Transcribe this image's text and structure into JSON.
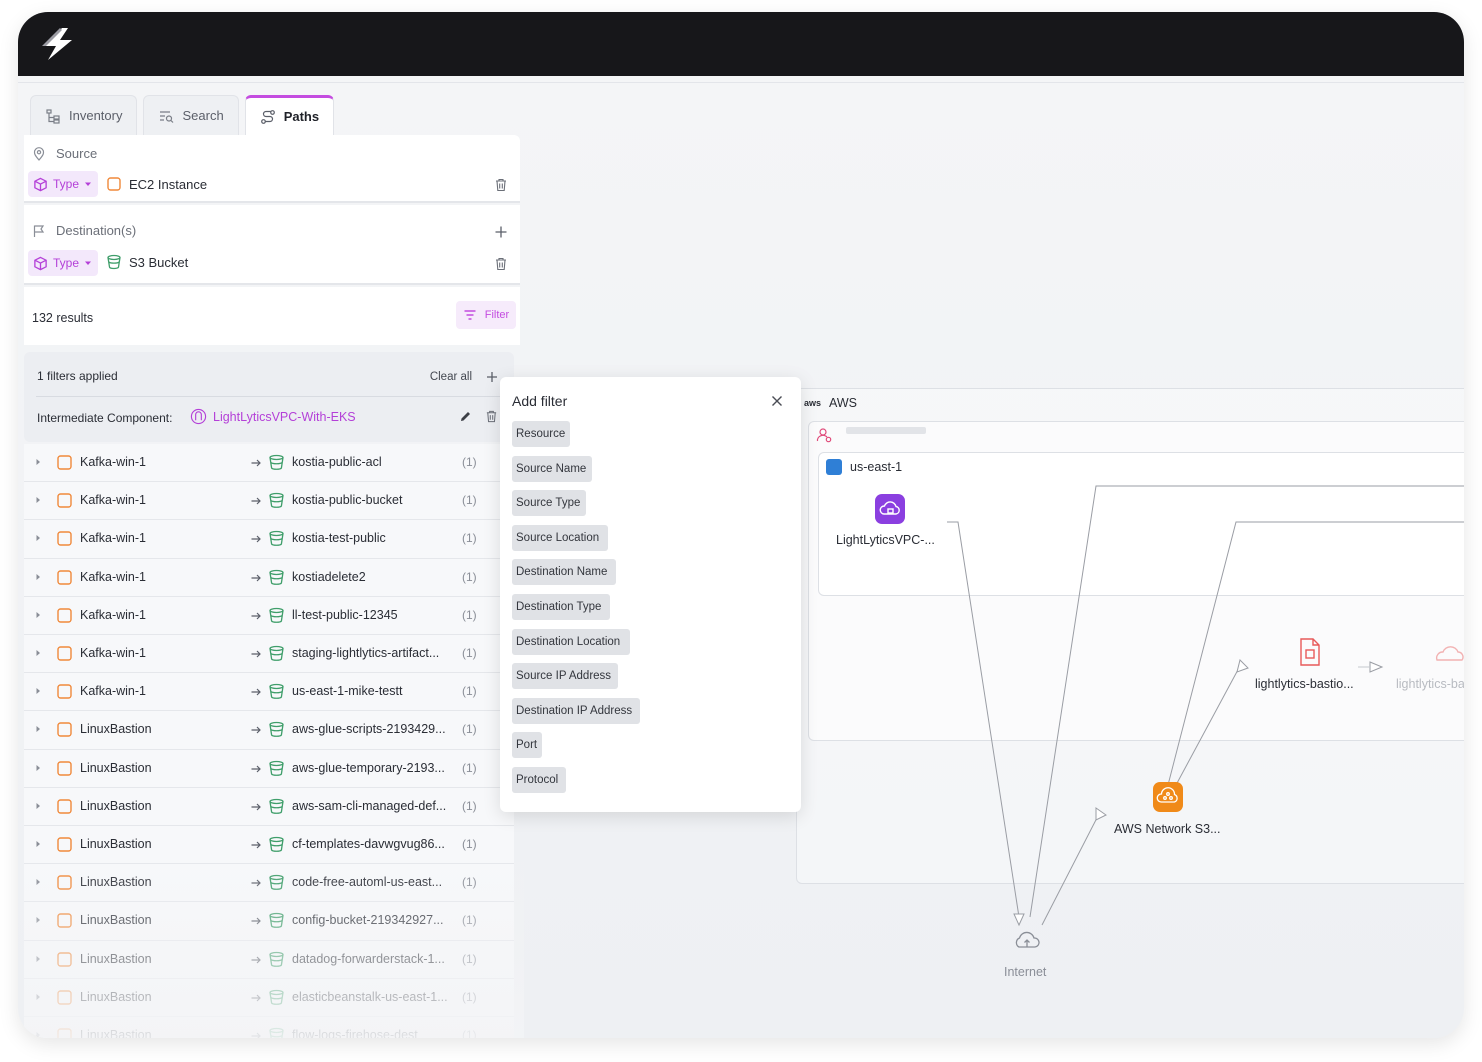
{
  "tabs": [
    {
      "label": "Inventory",
      "icon": "tree-icon"
    },
    {
      "label": "Search",
      "icon": "list-search-icon"
    },
    {
      "label": "Paths",
      "icon": "route-icon"
    }
  ],
  "source": {
    "label": "Source",
    "type_label": "Type",
    "entity": "EC2 Instance"
  },
  "destination": {
    "label": "Destination(s)",
    "type_label": "Type",
    "entity": "S3 Bucket"
  },
  "results": {
    "count_text": "132 results",
    "filter_label": "Filter"
  },
  "applied_filters": {
    "header": "1 filters applied",
    "clear_all": "Clear all",
    "component_label": "Intermediate Component:",
    "component_value": "LightLyticsVPC-With-EKS"
  },
  "paths": [
    {
      "source": "Kafka-win-1",
      "destination": "kostia-public-acl",
      "count": "(1)"
    },
    {
      "source": "Kafka-win-1",
      "destination": "kostia-public-bucket",
      "count": "(1)"
    },
    {
      "source": "Kafka-win-1",
      "destination": "kostia-test-public",
      "count": "(1)"
    },
    {
      "source": "Kafka-win-1",
      "destination": "kostiadelete2",
      "count": "(1)"
    },
    {
      "source": "Kafka-win-1",
      "destination": "ll-test-public-12345",
      "count": "(1)"
    },
    {
      "source": "Kafka-win-1",
      "destination": "staging-lightlytics-artifact...",
      "count": "(1)"
    },
    {
      "source": "Kafka-win-1",
      "destination": "us-east-1-mike-testt",
      "count": "(1)"
    },
    {
      "source": "LinuxBastion",
      "destination": "aws-glue-scripts-2193429...",
      "count": "(1)"
    },
    {
      "source": "LinuxBastion",
      "destination": "aws-glue-temporary-2193...",
      "count": "(1)"
    },
    {
      "source": "LinuxBastion",
      "destination": "aws-sam-cli-managed-def...",
      "count": "(1)"
    },
    {
      "source": "LinuxBastion",
      "destination": "cf-templates-davwgvug86...",
      "count": "(1)"
    },
    {
      "source": "LinuxBastion",
      "destination": "code-free-automl-us-east...",
      "count": "(1)"
    },
    {
      "source": "LinuxBastion",
      "destination": "config-bucket-219342927...",
      "count": "(1)"
    },
    {
      "source": "LinuxBastion",
      "destination": "datadog-forwarderstack-1...",
      "count": "(1)"
    },
    {
      "source": "LinuxBastion",
      "destination": "elasticbeanstalk-us-east-1...",
      "count": "(1)"
    },
    {
      "source": "LinuxBastion",
      "destination": "flow-logs-firehose-dest",
      "count": "(1)"
    }
  ],
  "add_filter": {
    "title": "Add filter",
    "options": [
      "Resource",
      "Source Name",
      "Source Type",
      "Source Location",
      "Destination Name",
      "Destination Type",
      "Destination Location",
      "Source IP Address",
      "Destination IP Address",
      "Port",
      "Protocol"
    ]
  },
  "canvas": {
    "cloud_label": "AWS",
    "cloud_logo": "aws",
    "region": "us-east-1",
    "nodes": {
      "vpc": "LightLyticsVPC-...",
      "bastion": "lightlytics-bastio...",
      "bastion2": "lightlytics-ba",
      "network": "AWS Network S3...",
      "internet": "Internet"
    }
  },
  "colors": {
    "accent": "#c44ce0",
    "topbar": "#17171a",
    "ec2_orange": "#f0893a",
    "s3_green": "#3f9e6a",
    "vpc_purple": "#8b3fe0",
    "network_orange": "#f08a19"
  }
}
